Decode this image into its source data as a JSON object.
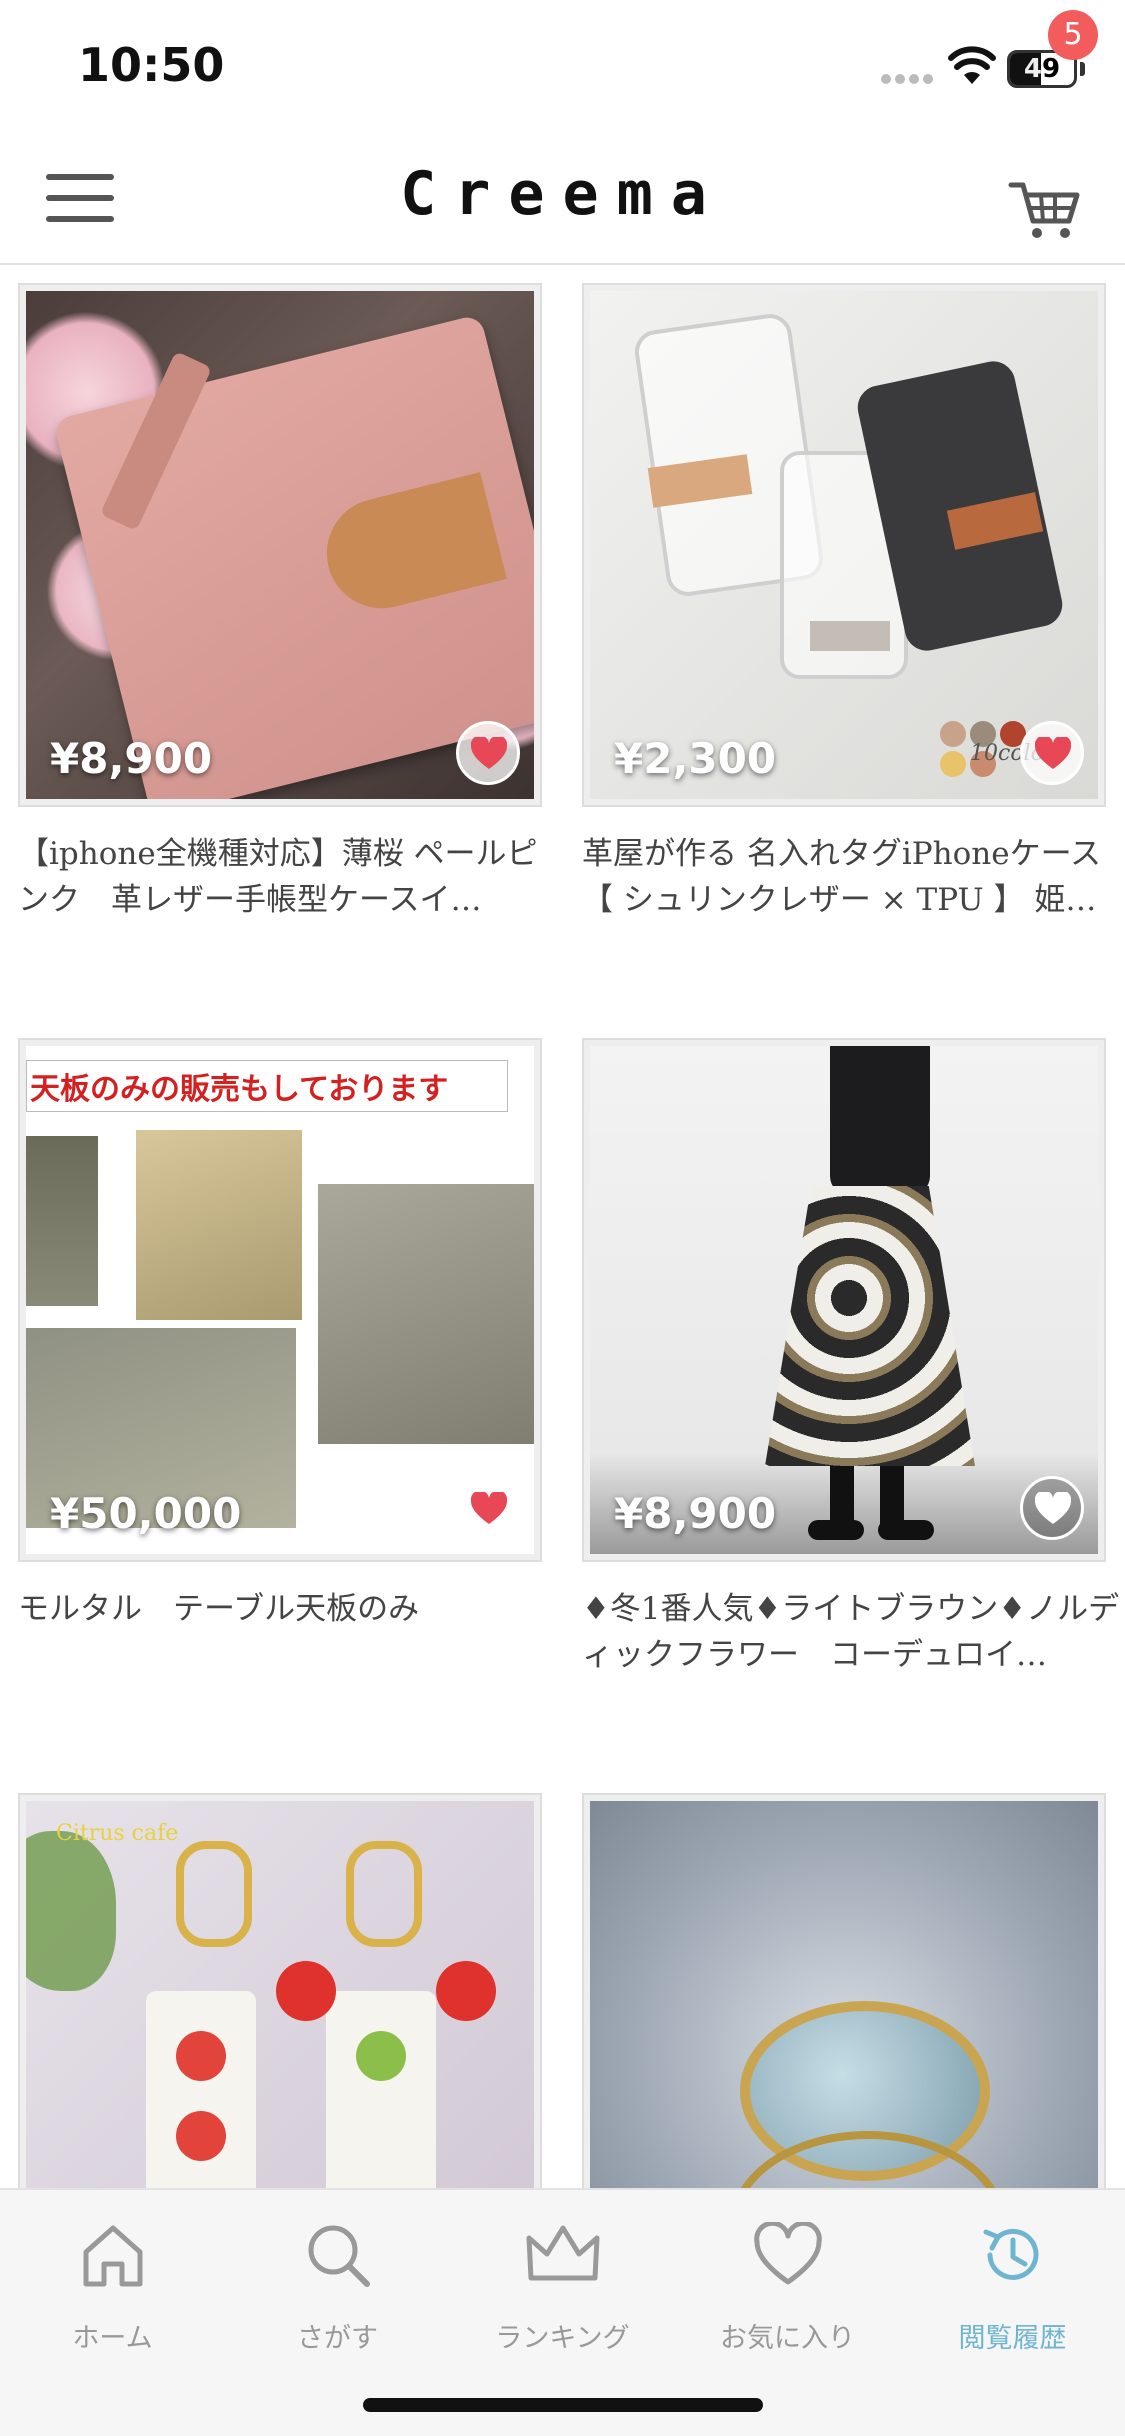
{
  "status_bar": {
    "time": "10:50",
    "battery": "49"
  },
  "header": {
    "logo": "Creema",
    "cart_count": "5"
  },
  "products": [
    {
      "price": "¥8,900",
      "title": "【iphone全機種対応】薄桜 ペールピンク　革レザー手帳型ケースイ…",
      "favorited": true
    },
    {
      "price": "¥2,300",
      "title": "革屋が作る 名入れタグiPhoneケース【 シュリンクレザー × TPU 】 姫…",
      "favorited": true,
      "overlay_text": "10color"
    },
    {
      "price": "¥50,000",
      "title": "モルタル　テーブル天板のみ",
      "favorited": true,
      "banner_text": "天板のみの販売もしております"
    },
    {
      "price": "¥8,900",
      "title": "♦冬1番人気♦ライトブラウン♦ノルディックフラワー　コーデュロイ…",
      "favorited": false
    },
    {
      "price": "",
      "title": "",
      "overlay_text": "Citrus cafe"
    },
    {
      "price": "",
      "title": ""
    }
  ],
  "tab_bar": {
    "items": [
      {
        "label": "ホーム",
        "icon": "home-icon"
      },
      {
        "label": "さがす",
        "icon": "search-icon"
      },
      {
        "label": "ランキング",
        "icon": "crown-icon"
      },
      {
        "label": "お気に入り",
        "icon": "heart-icon"
      },
      {
        "label": "閲覧履歴",
        "icon": "history-icon",
        "active": true
      }
    ]
  },
  "colors": {
    "accent": "#6fb5d2",
    "badge": "#f25c5c",
    "heart": "#e84855"
  }
}
